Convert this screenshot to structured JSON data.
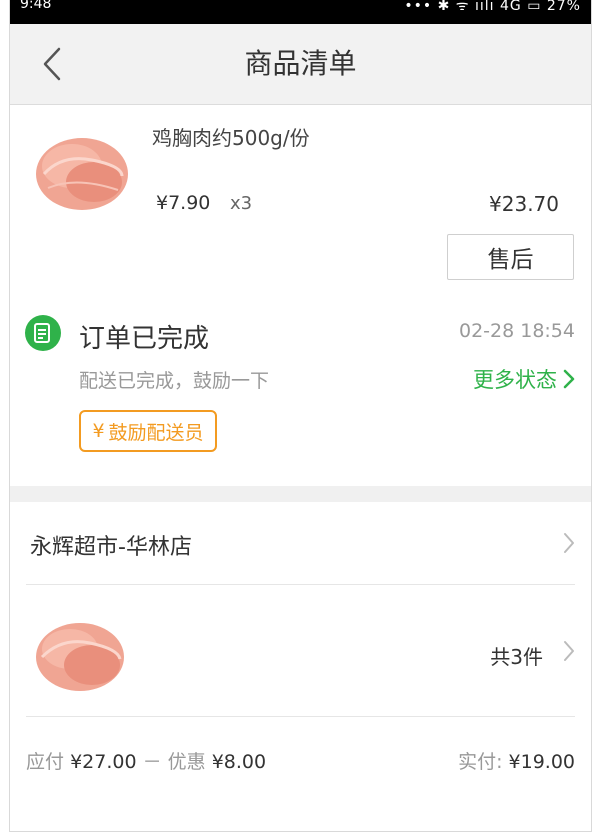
{
  "status_bar": {
    "time": "9:48",
    "right": "••• ✱ ᯤ ıılı 4G ▭ 27%"
  },
  "nav": {
    "title": "商品清单",
    "back_icon": "chevron-left-icon"
  },
  "product": {
    "name": "鸡胸肉约500g/份",
    "unit_price": "¥7.90",
    "quantity": "x3",
    "line_total": "¥23.70",
    "after_sale_label": "售后"
  },
  "order_status": {
    "title": "订单已完成",
    "time": "02-28 18:54",
    "subtitle": "配送已完成，鼓励一下",
    "more_label": "更多状态",
    "encourage_label": "鼓励配送员",
    "encourage_symbol": "¥",
    "accent_color": "#2fb24a",
    "encourage_color": "#f39b21"
  },
  "store": {
    "name": "永辉超市-华林店"
  },
  "items_summary": {
    "count_label": "共3件"
  },
  "totals": {
    "payable_label": "应付",
    "payable_value": "¥27.00",
    "discount_label": "－ 优惠",
    "discount_value": "¥8.00",
    "paid_label": "实付:",
    "paid_value": "¥19.00"
  }
}
